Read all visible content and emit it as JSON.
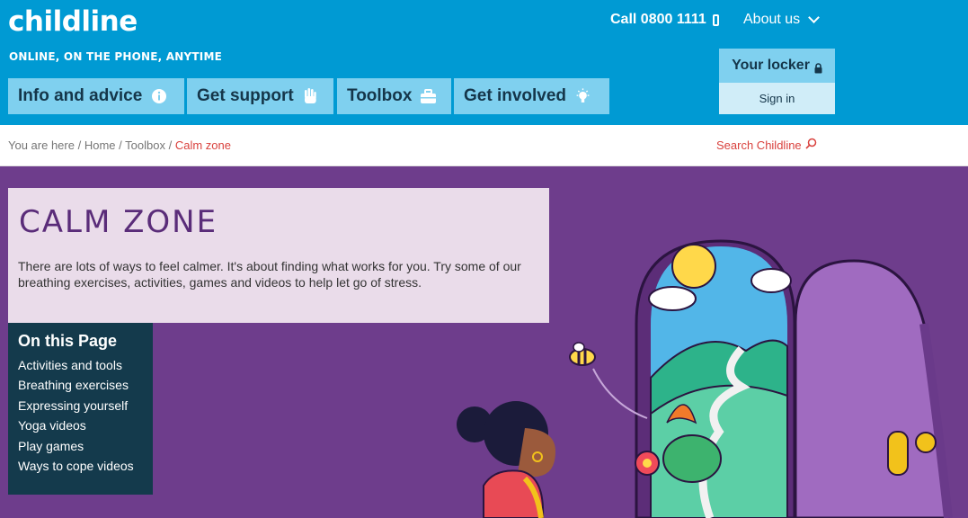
{
  "header": {
    "logo": "childline",
    "tagline": "ONLINE, ON THE PHONE, ANYTIME",
    "call_label": "Call 0800 1111",
    "about_label": "About us"
  },
  "nav": [
    {
      "label": "Info and advice",
      "icon": "info-icon"
    },
    {
      "label": "Get support",
      "icon": "hand-icon"
    },
    {
      "label": "Toolbox",
      "icon": "toolbox-icon"
    },
    {
      "label": "Get involved",
      "icon": "lightbulb-icon"
    }
  ],
  "locker": {
    "title": "Your locker",
    "signin": "Sign in"
  },
  "breadcrumb": {
    "prefix": "You are here",
    "items": [
      "Home",
      "Toolbox"
    ],
    "current": "Calm zone"
  },
  "search": {
    "label": "Search Childline"
  },
  "intro": {
    "title": "CALM ZONE",
    "text": "There are lots of ways to feel calmer. It's about finding what works for you. Try some of our breathing exercises, activities, games and videos to help let go of stress."
  },
  "on_this_page": {
    "title": "On this Page",
    "links": [
      "Activities and tools",
      "Breathing exercises",
      "Expressing yourself",
      "Yoga videos",
      "Play games",
      "Ways to cope videos"
    ]
  },
  "colors": {
    "header_bg": "#009ad3",
    "nav_bg": "#7fd0ef",
    "page_bg": "#6e3d8c",
    "intro_bg": "#eadcea",
    "sidebar_bg": "#143a4c",
    "accent_red": "#d9413d"
  }
}
